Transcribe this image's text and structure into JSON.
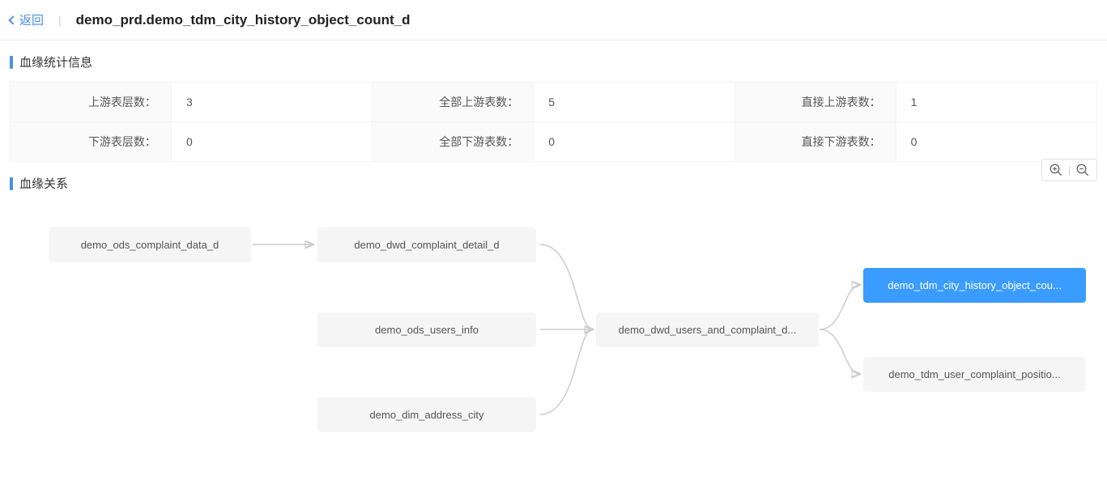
{
  "header": {
    "back_label": "返回",
    "title": "demo_prd.demo_tdm_city_history_object_count_d"
  },
  "stats": {
    "section_title": "血缘统计信息",
    "rows": [
      {
        "label1": "上游表层数：",
        "value1": "3",
        "label2": "全部上游表数：",
        "value2": "5",
        "label3": "直接上游表数：",
        "value3": "1"
      },
      {
        "label1": "下游表层数：",
        "value1": "0",
        "label2": "全部下游表数：",
        "value2": "0",
        "label3": "直接下游表数：",
        "value3": "0"
      }
    ]
  },
  "relation": {
    "section_title": "血缘关系",
    "zoom_separator": "|",
    "nodes": {
      "n1": "demo_ods_complaint_data_d",
      "n2": "demo_dwd_complaint_detail_d",
      "n3": "demo_ods_users_info",
      "n4": "demo_dim_address_city",
      "n5": "demo_dwd_users_and_complaint_d...",
      "n6": "demo_tdm_city_history_object_cou...",
      "n7": "demo_tdm_user_complaint_positio..."
    }
  }
}
